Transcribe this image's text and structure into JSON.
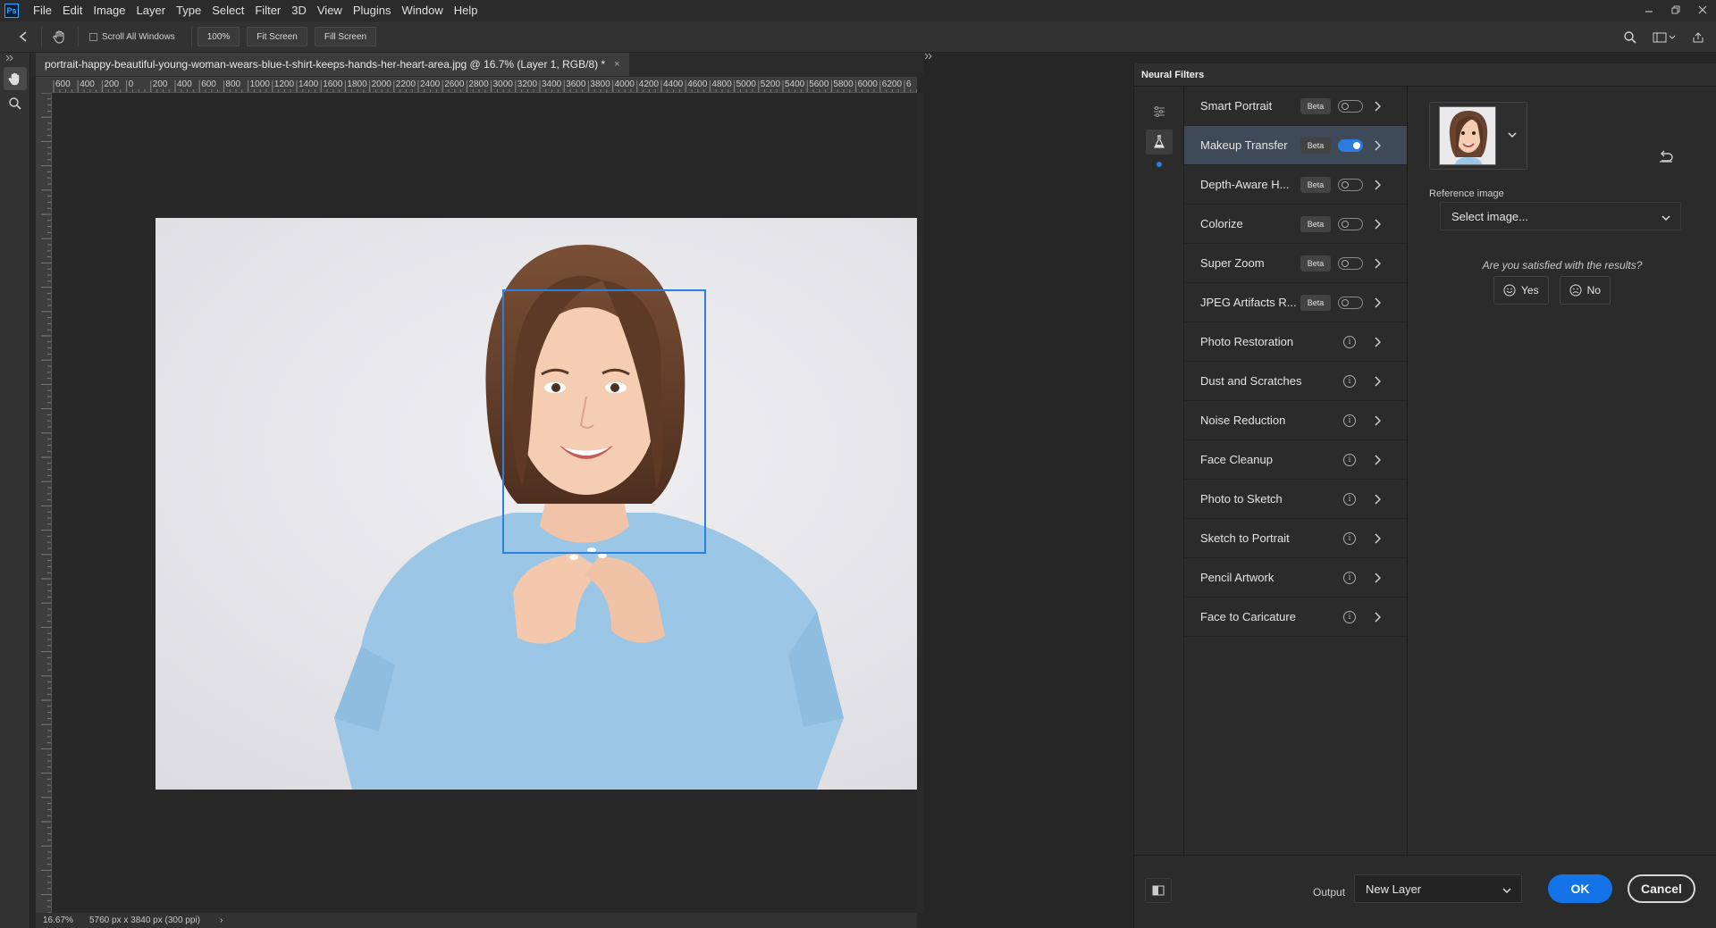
{
  "menu": {
    "logo": "Ps",
    "items": [
      "File",
      "Edit",
      "Image",
      "Layer",
      "Type",
      "Select",
      "Filter",
      "3D",
      "View",
      "Plugins",
      "Window",
      "Help"
    ]
  },
  "options": {
    "scroll_all_windows": "Scroll All Windows",
    "zoom_100": "100%",
    "fit_screen": "Fit Screen",
    "fill_screen": "Fill Screen"
  },
  "document": {
    "tab_title": "portrait-happy-beautiful-young-woman-wears-blue-t-shirt-keeps-hands-her-heart-area.jpg @ 16.7% (Layer 1, RGB/8) *",
    "close": "×",
    "ruler_top_labels": [
      "600",
      "400",
      "200",
      "0",
      "200",
      "400",
      "600",
      "800",
      "1000",
      "1200",
      "1400",
      "1600",
      "1800",
      "2000",
      "2200",
      "2400",
      "2600",
      "2800",
      "3000",
      "3200",
      "3400",
      "3600",
      "3800",
      "4000",
      "4200",
      "4400",
      "4600",
      "4800",
      "5000",
      "5200",
      "5400",
      "5600",
      "5800",
      "6000",
      "6200",
      "6"
    ],
    "zoom": "16.67%",
    "dimensions": "5760 px x 3840 px (300 ppi)",
    "status_arrow": "›"
  },
  "neural_filters": {
    "title": "Neural Filters",
    "filters": [
      {
        "name": "Smart Portrait",
        "beta": "Beta",
        "kind": "toggle",
        "on": false
      },
      {
        "name": "Makeup Transfer",
        "beta": "Beta",
        "kind": "toggle",
        "on": true,
        "selected": true
      },
      {
        "name": "Depth-Aware H...",
        "beta": "Beta",
        "kind": "toggle",
        "on": false
      },
      {
        "name": "Colorize",
        "beta": "Beta",
        "kind": "toggle",
        "on": false
      },
      {
        "name": "Super Zoom",
        "beta": "Beta",
        "kind": "toggle",
        "on": false
      },
      {
        "name": "JPEG Artifacts R...",
        "beta": "Beta",
        "kind": "toggle",
        "on": false
      },
      {
        "name": "Photo Restoration",
        "kind": "info"
      },
      {
        "name": "Dust and Scratches",
        "kind": "info"
      },
      {
        "name": "Noise Reduction",
        "kind": "info"
      },
      {
        "name": "Face Cleanup",
        "kind": "info"
      },
      {
        "name": "Photo to Sketch",
        "kind": "info"
      },
      {
        "name": "Sketch to Portrait",
        "kind": "info"
      },
      {
        "name": "Pencil Artwork",
        "kind": "info"
      },
      {
        "name": "Face to Caricature",
        "kind": "info"
      }
    ],
    "info_glyph": "i",
    "reference_label": "Reference image",
    "reference_select": "Select image...",
    "satisfied": "Are you satisfied with the results?",
    "yes": "Yes",
    "no": "No",
    "output_label": "Output",
    "output_value": "New Layer",
    "ok": "OK",
    "cancel": "Cancel"
  },
  "colors": {
    "accent": "#1473e6",
    "face_box": "#2b7fe0",
    "shirt": "#9cc6e6",
    "background": "#e6e6ea"
  }
}
